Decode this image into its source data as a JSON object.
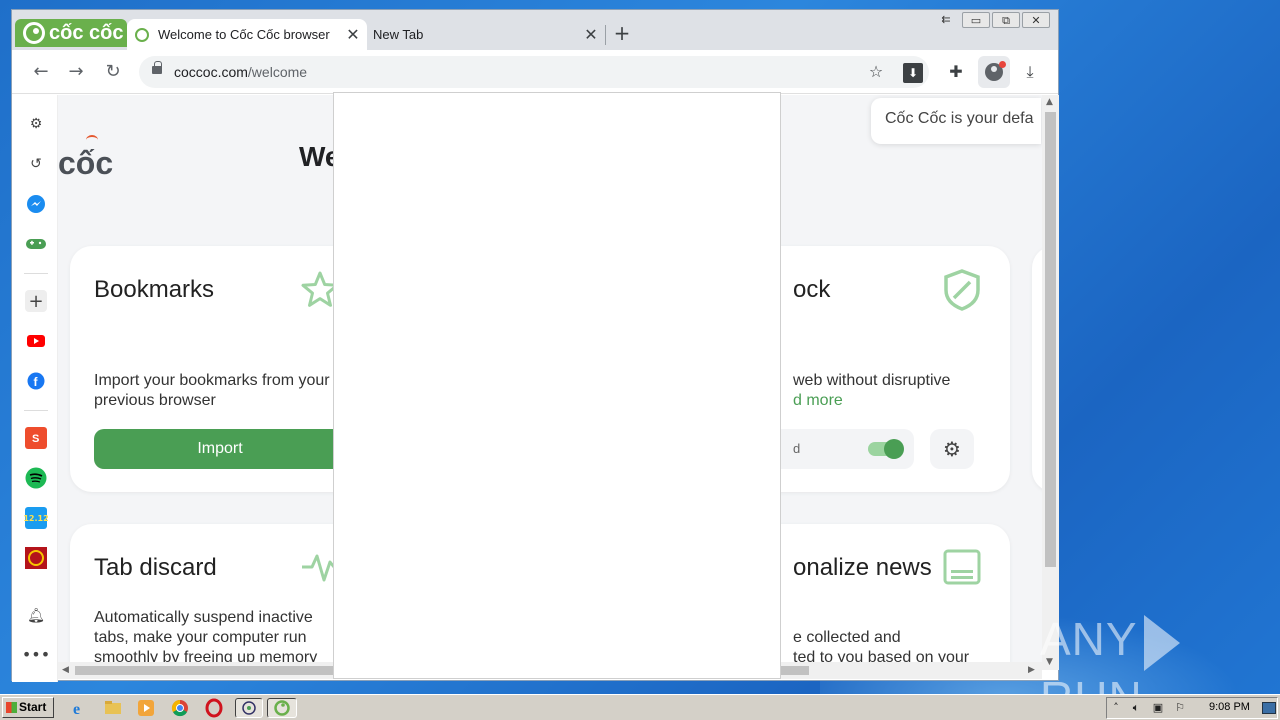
{
  "browser": {
    "logo_text": "cốc cốc",
    "tabs": [
      {
        "title": "Welcome to Cốc Cốc browser",
        "active": true
      },
      {
        "title": "New Tab",
        "active": false
      }
    ],
    "new_tab_label": "+",
    "address": {
      "host": "coccoc.com",
      "path": "/welcome"
    }
  },
  "page": {
    "brand_word": "cốc",
    "welcome_heading": "We",
    "notice_text": "Cốc Cốc is your defa",
    "cards": {
      "bookmarks": {
        "title": "Bookmarks",
        "description": "Import your bookmarks from your previous browser",
        "button_label": "Import"
      },
      "adblock": {
        "title_partial": "ock",
        "description_partial": "web without disruptive",
        "learn_more_partial": "d more",
        "toggle_label_partial": "d",
        "toggle_on": true
      },
      "tab_discard": {
        "title": "Tab discard",
        "description": "Automatically suspend inactive tabs, make your computer run smoothly by freeing up memory"
      },
      "news": {
        "title_partial": "onalize news",
        "description_partial_1": "e collected and",
        "description_partial_2": "ted to you based on your"
      }
    }
  },
  "sidebar": {
    "items": [
      "gear-icon",
      "history-icon",
      "messenger-icon",
      "game-icon",
      "add-icon",
      "youtube-icon",
      "facebook-icon",
      "shopee-icon",
      "spotify-icon",
      "tiki-icon",
      "vtv-icon",
      "bell-icon",
      "more-icon"
    ],
    "tiki_badge": "12.12"
  },
  "watermark": {
    "left": "ANY",
    "right": "RUN"
  },
  "taskbar": {
    "start_label": "Start",
    "clock": "9:08 PM"
  },
  "colors": {
    "brand_green": "#4a9e54",
    "logo_green": "#6ab04c"
  }
}
